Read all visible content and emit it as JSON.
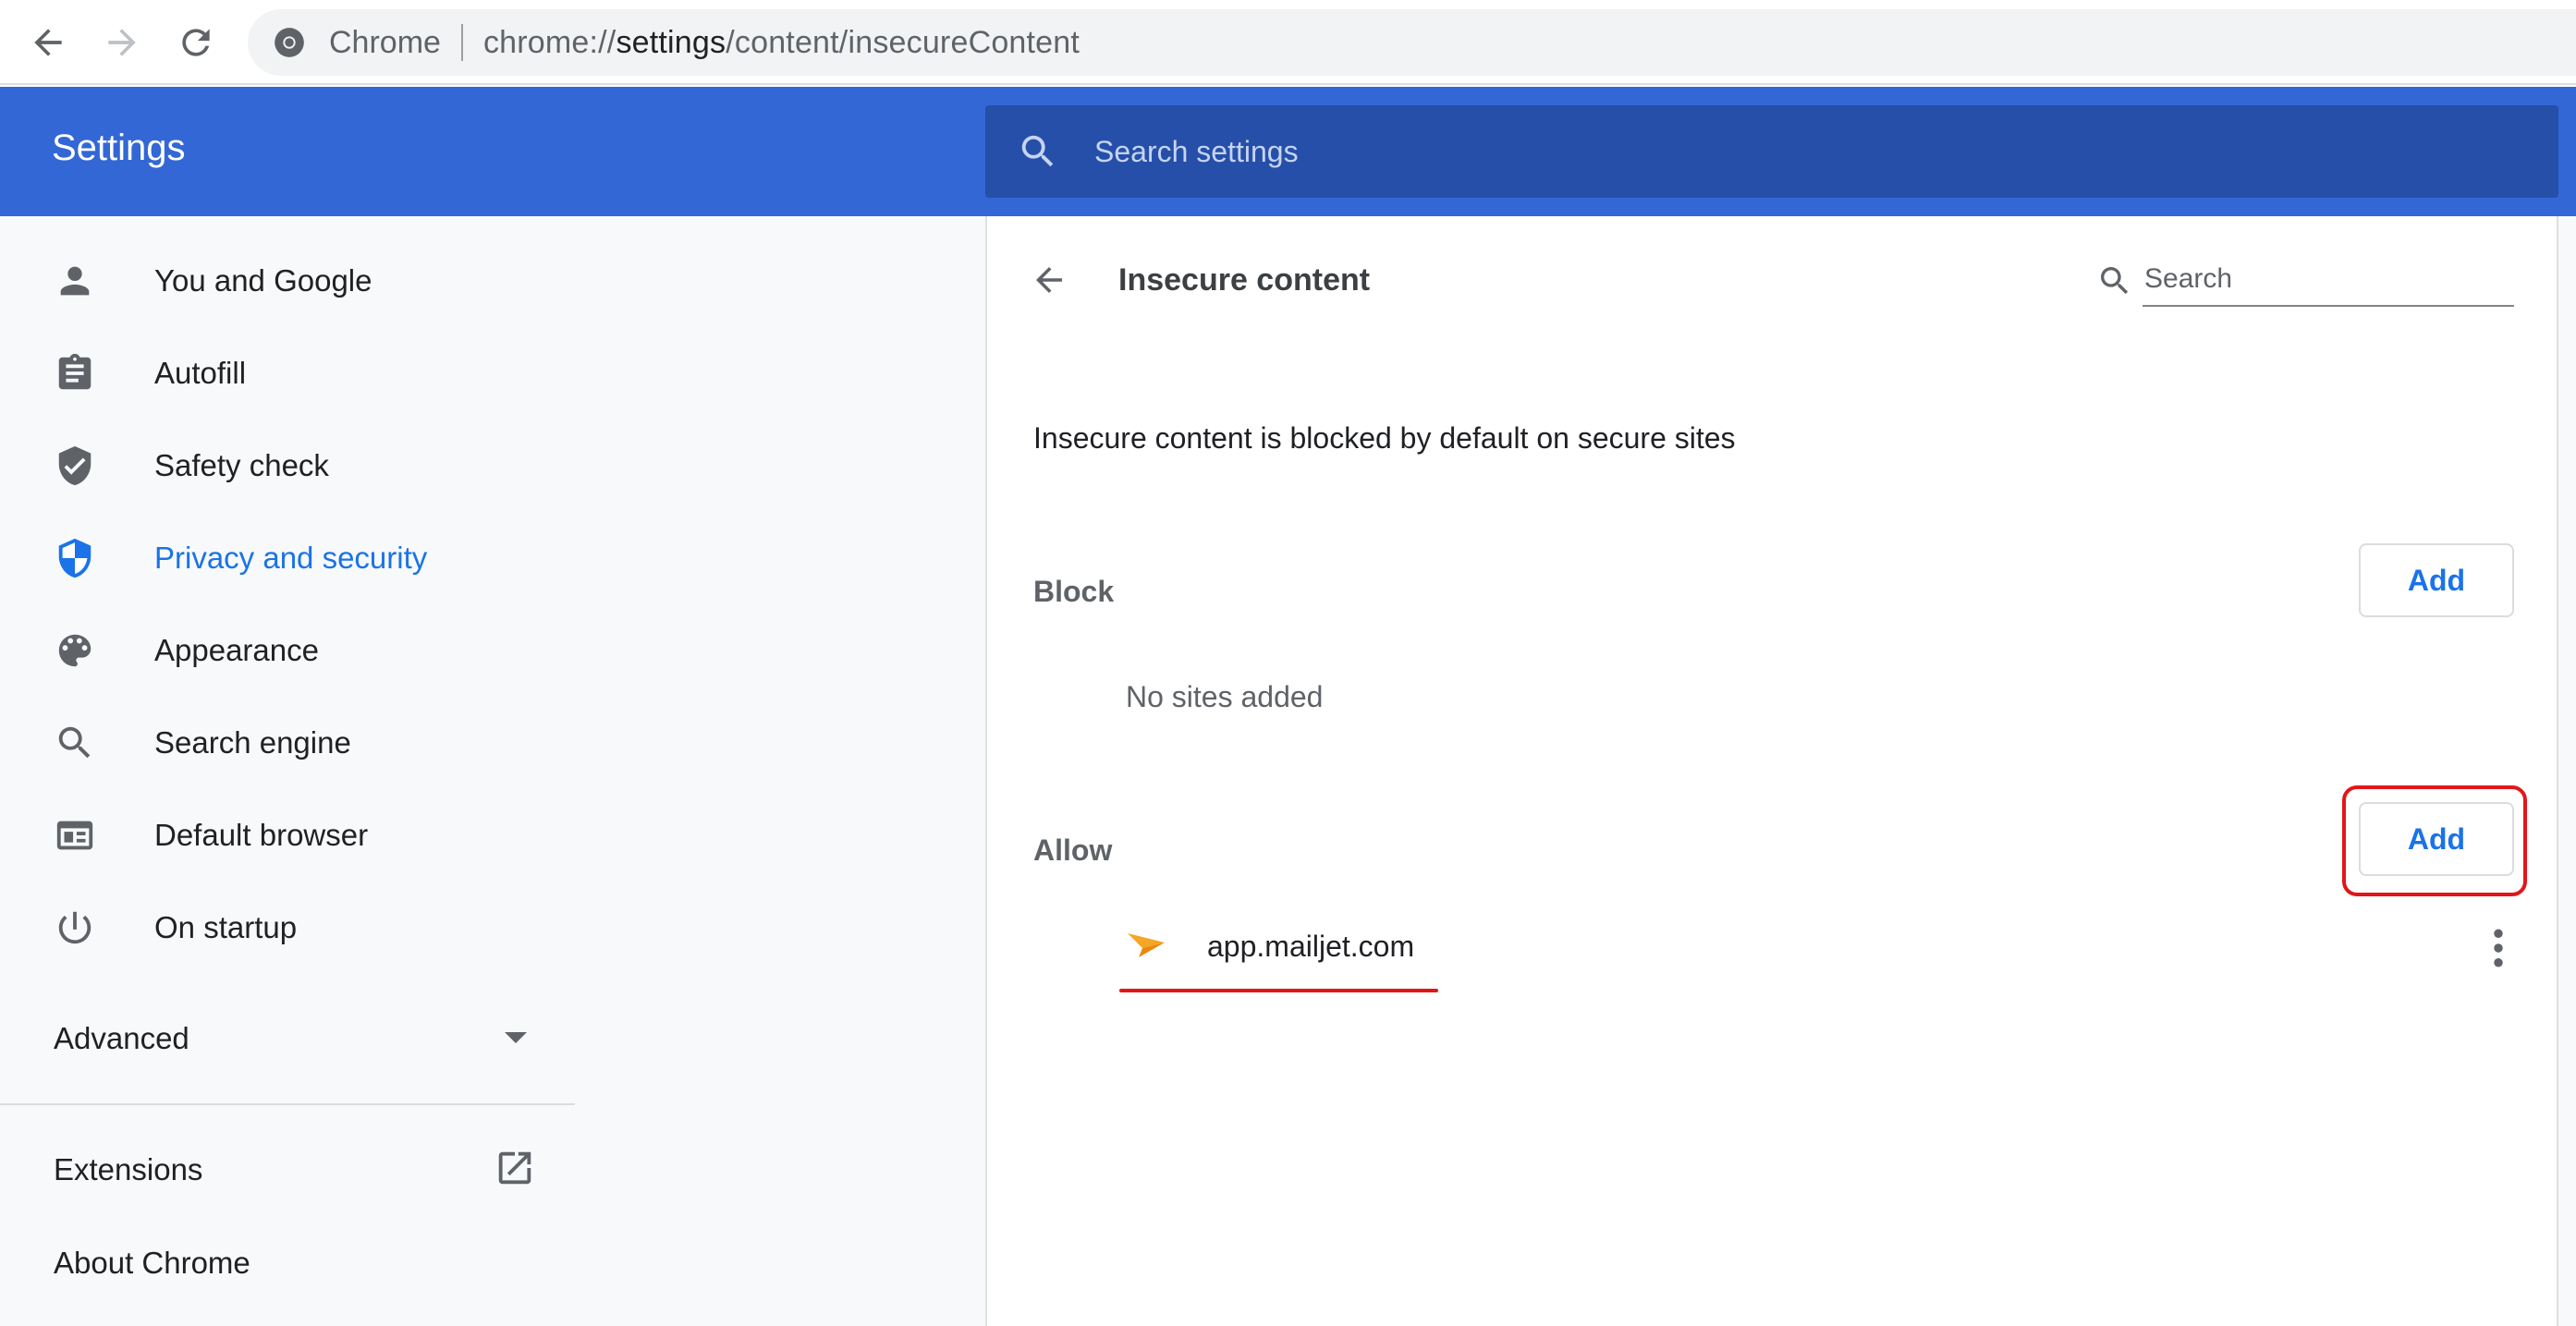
{
  "browser": {
    "chip_label": "Chrome",
    "url_scheme": "chrome://",
    "url_host": "settings",
    "url_path": "/content/insecureContent"
  },
  "header": {
    "title": "Settings",
    "search_placeholder": "Search settings"
  },
  "sidebar": {
    "items": [
      {
        "label": "You and Google",
        "icon": "person-icon"
      },
      {
        "label": "Autofill",
        "icon": "clipboard-icon"
      },
      {
        "label": "Safety check",
        "icon": "shield-check-icon"
      },
      {
        "label": "Privacy and security",
        "icon": "shield-icon",
        "active": true
      },
      {
        "label": "Appearance",
        "icon": "palette-icon"
      },
      {
        "label": "Search engine",
        "icon": "search-icon"
      },
      {
        "label": "Default browser",
        "icon": "browser-window-icon"
      },
      {
        "label": "On startup",
        "icon": "power-icon"
      }
    ],
    "advanced_label": "Advanced",
    "extensions_label": "Extensions",
    "about_label": "About Chrome"
  },
  "page": {
    "title": "Insecure content",
    "search_placeholder": "Search",
    "description": "Insecure content is blocked by default on secure sites",
    "block": {
      "label": "Block",
      "add_label": "Add",
      "empty_text": "No sites added"
    },
    "allow": {
      "label": "Allow",
      "add_label": "Add",
      "sites": [
        {
          "name": "app.mailjet.com",
          "favicon": "mailjet-arrow-icon"
        }
      ]
    }
  },
  "colors": {
    "header_blue": "#3367d6",
    "search_blue": "#254fa8",
    "accent": "#1a73e8",
    "annotation_red": "#e3151a",
    "mailjet_orange": "#f5a623"
  }
}
